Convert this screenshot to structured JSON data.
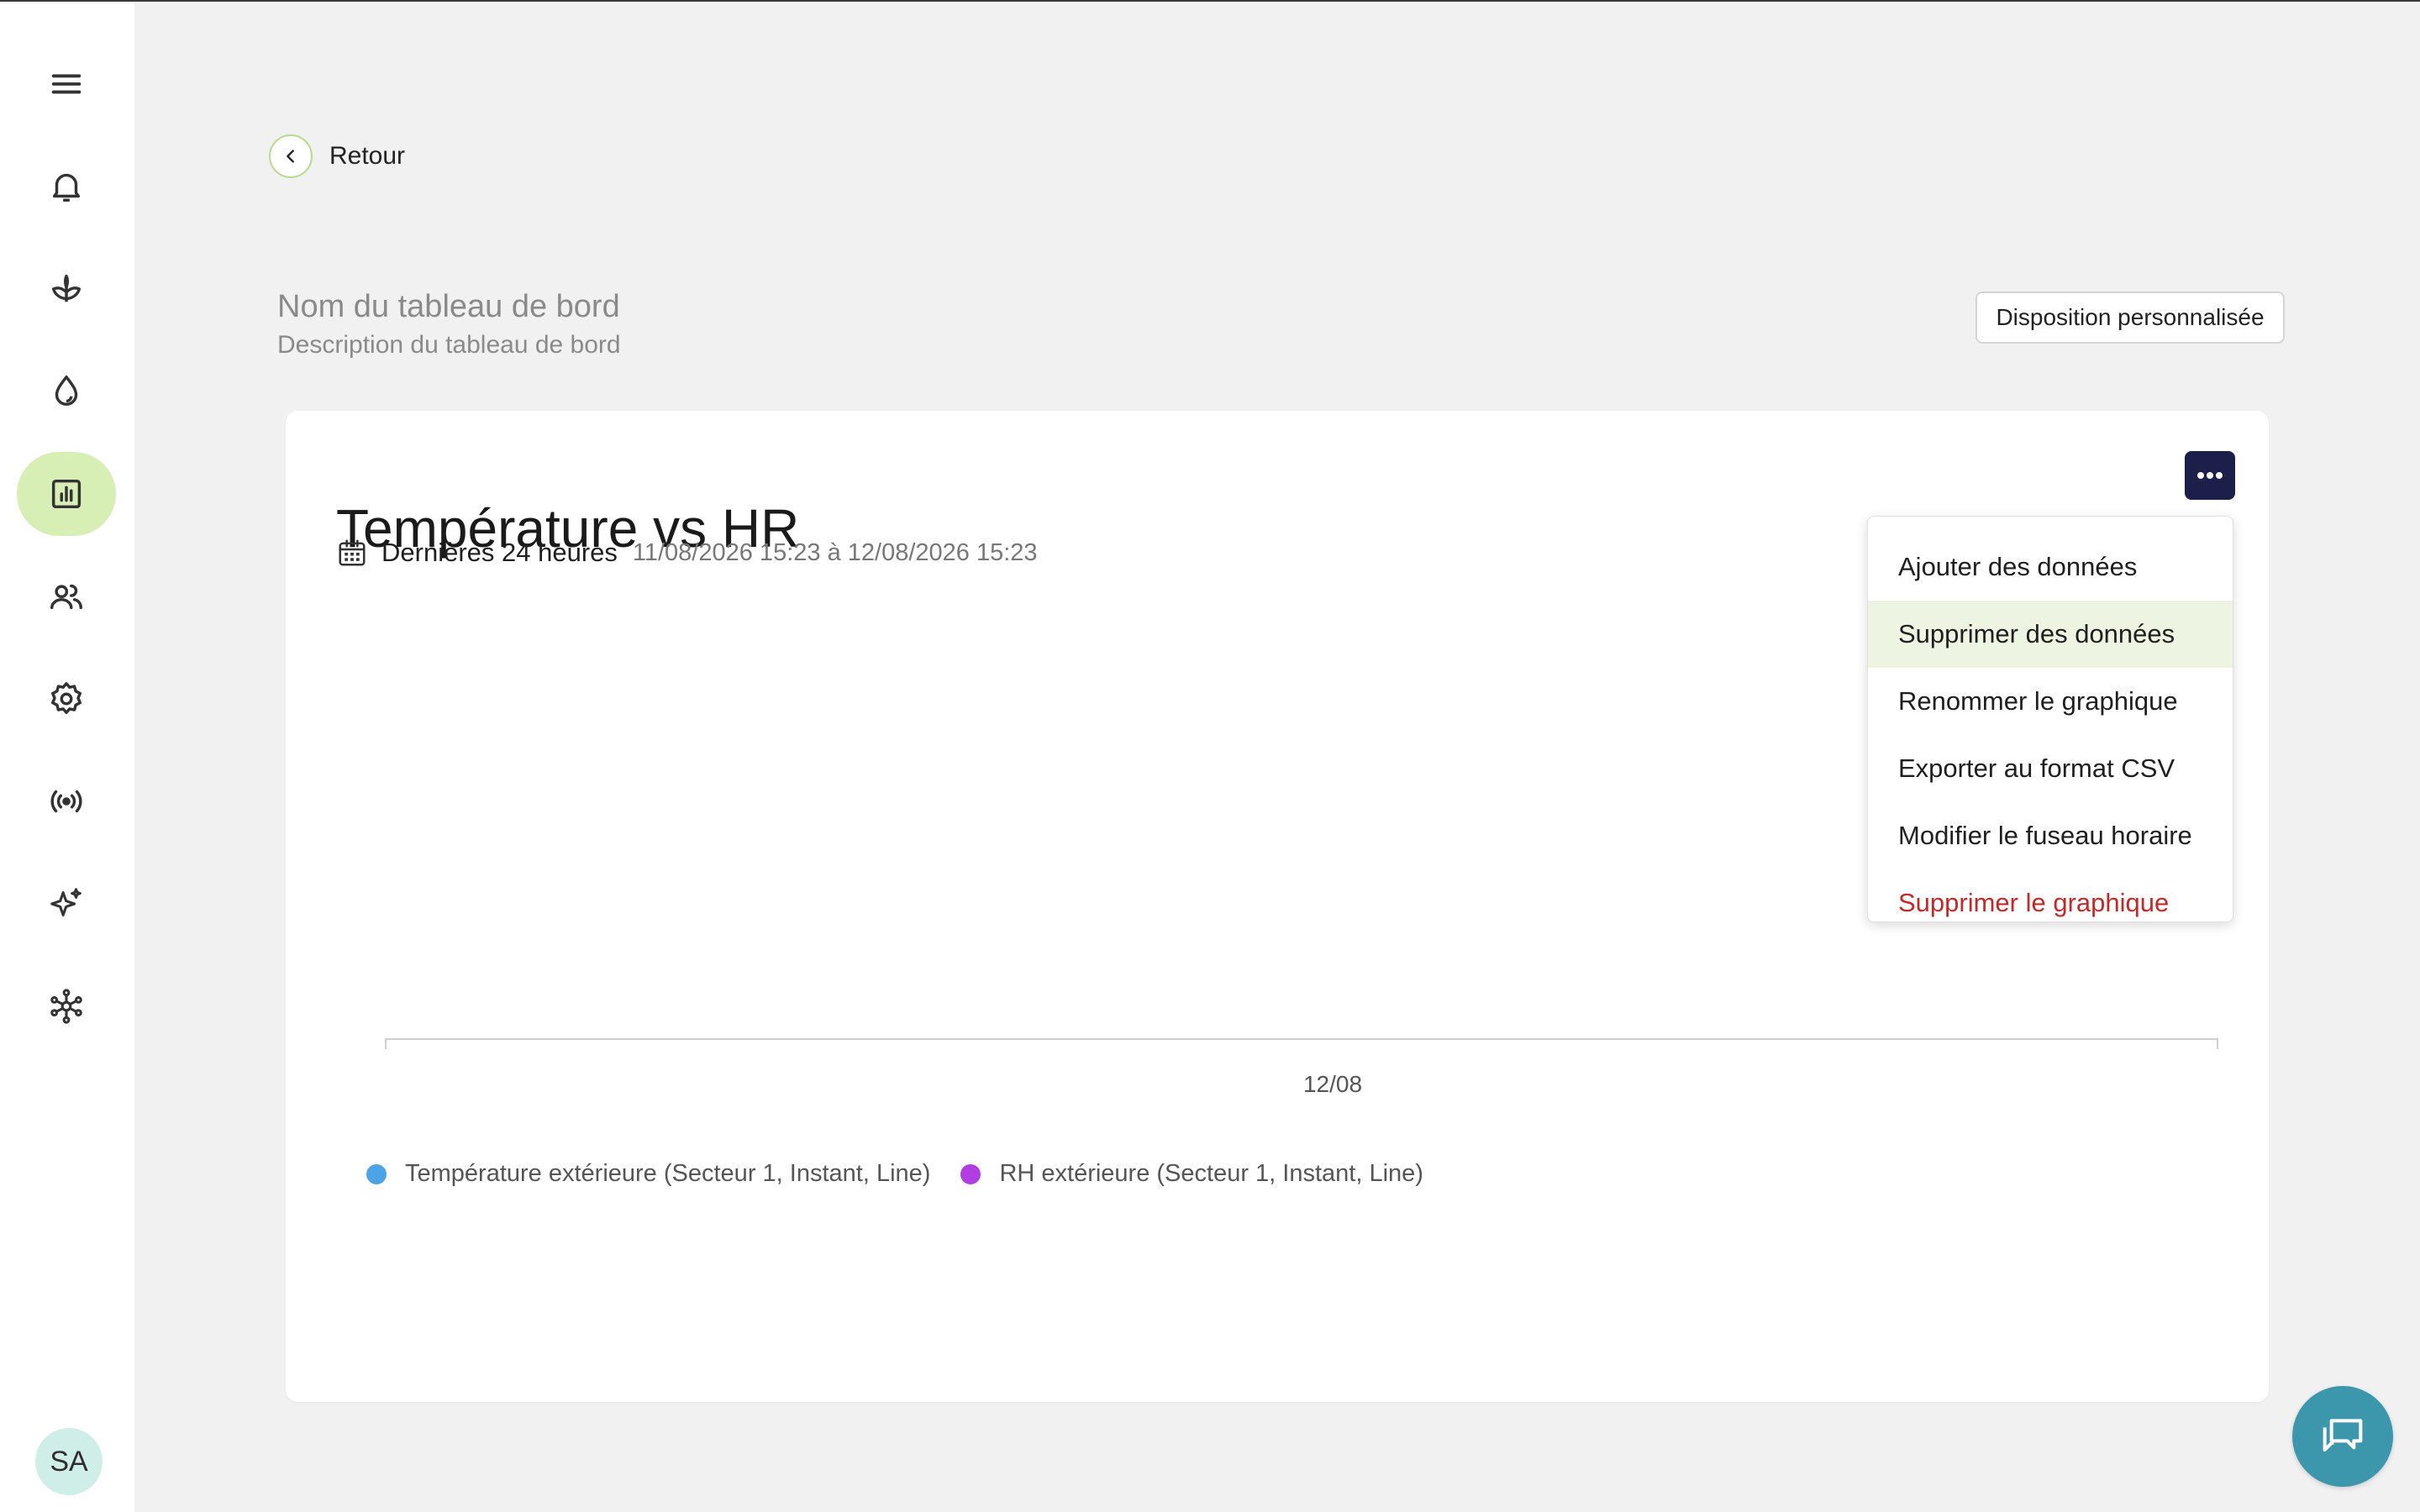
{
  "sidebar": {
    "items": [
      {
        "icon": "menu-icon"
      },
      {
        "icon": "bell-icon"
      },
      {
        "icon": "plant-icon"
      },
      {
        "icon": "water-drop-icon"
      },
      {
        "icon": "chart-icon",
        "active": true
      },
      {
        "icon": "users-icon"
      },
      {
        "icon": "gear-icon"
      },
      {
        "icon": "broadcast-icon"
      },
      {
        "icon": "sparkle-icon"
      },
      {
        "icon": "network-icon"
      }
    ],
    "avatar_initials": "SA"
  },
  "back": {
    "label": "Retour"
  },
  "dashboard": {
    "name": "Nom du tableau de bord",
    "description": "Description du tableau de bord",
    "layout_button": "Disposition personnalisée"
  },
  "chart_card": {
    "title": "Température vs HR",
    "range_label": "Dernières 24 heures",
    "range_dates": "11/08/2026 15:23 à 12/08/2026 15:23",
    "more_icon": "ellipsis-icon"
  },
  "chart_data": {
    "type": "line",
    "title": "Température vs HR",
    "x_tick_labels": [
      "12/08"
    ],
    "series": [
      {
        "name": "Température extérieure (Secteur 1, Instant, Line)",
        "color": "#4ea3e6",
        "values": []
      },
      {
        "name": "RH extérieure (Secteur 1, Instant, Line)",
        "color": "#b03ee0",
        "values": []
      }
    ],
    "legend_position": "bottom-left"
  },
  "menu": {
    "items": [
      {
        "label": "Ajouter des données"
      },
      {
        "label": "Supprimer des données",
        "hovered": true
      },
      {
        "label": "Renommer le graphique"
      },
      {
        "label": "Exporter au format CSV"
      },
      {
        "label": "Modifier le fuseau horaire"
      },
      {
        "label": "Supprimer le graphique",
        "danger": true
      }
    ]
  },
  "chat": {
    "icon": "chat-icon"
  },
  "colors": {
    "accent_green": "#d7eeb4",
    "menu_button": "#1c1f4a",
    "danger": "#c62828",
    "chat": "#3c97ad"
  }
}
